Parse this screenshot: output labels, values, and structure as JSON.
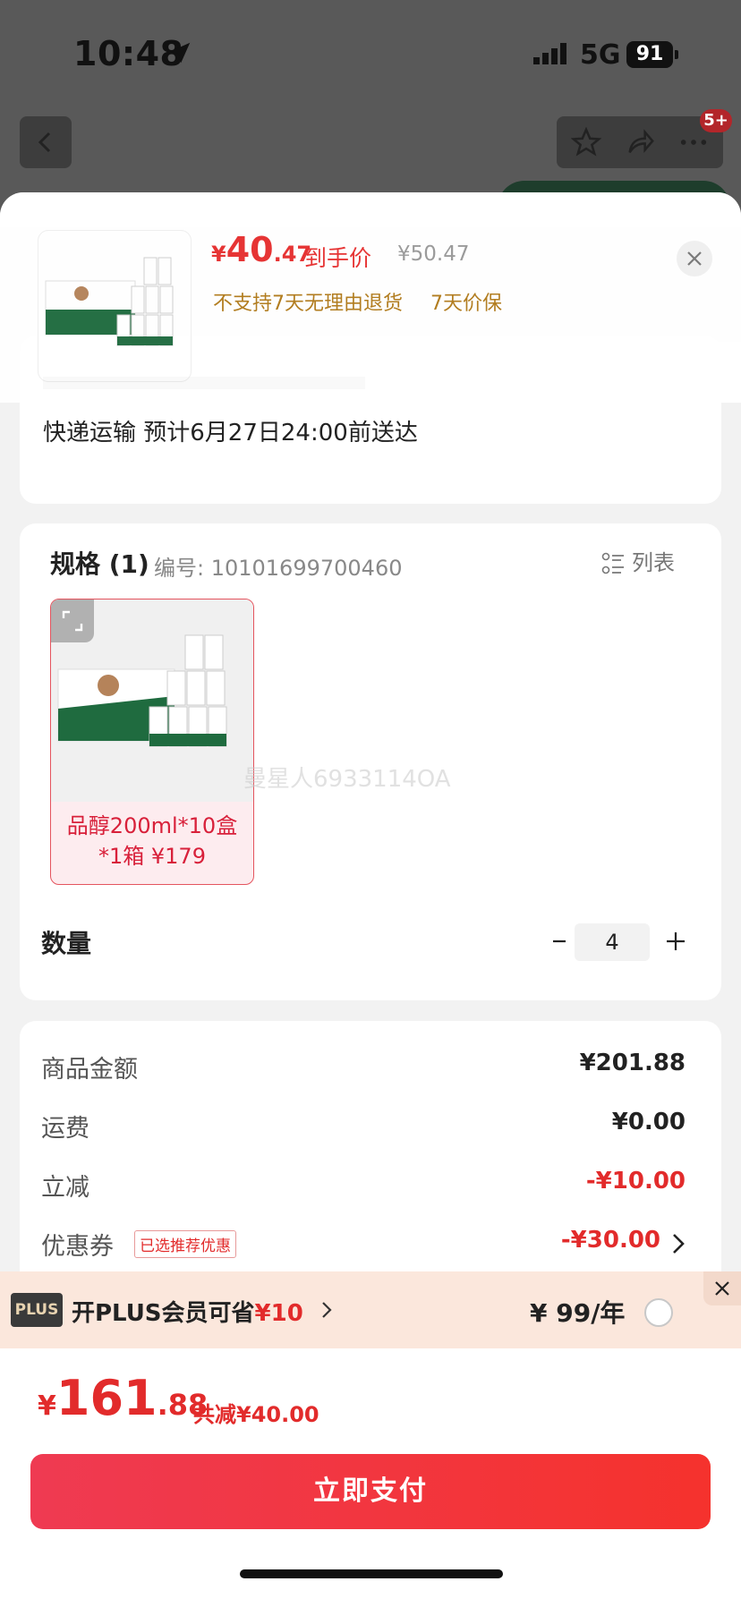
{
  "status_bar": {
    "time": "10:48",
    "network": "5G",
    "battery": "91"
  },
  "nav": {
    "cart_badge": "5+"
  },
  "sheet_header": {
    "price_currency": "¥",
    "price_int": "40",
    "price_dec": ".47",
    "price_tag": "到手价",
    "original_price": "¥50.47",
    "notes": [
      "不支持7天无理由退货",
      "7天价保"
    ]
  },
  "shipping": {
    "text": "快递运输 预计6月27日24:00前送达"
  },
  "spec": {
    "title": "规格 (1)",
    "code": "编号: 10101699700460",
    "list_label": "列表",
    "sku_label": "品醇200ml*10盒*1箱 ¥179",
    "watermark": "曼星人6933114OA",
    "quantity_label": "数量",
    "quantity_value": "4"
  },
  "summary": {
    "rows": [
      {
        "label": "商品金额",
        "value": "¥201.88"
      },
      {
        "label": "运费",
        "value": "¥0.00"
      },
      {
        "label": "立减",
        "value": "-¥10.00"
      },
      {
        "label": "优惠券",
        "value": "-¥30.00"
      }
    ],
    "coupon_tag": "已选推荐优惠"
  },
  "plus_bar": {
    "badge": "PLUS",
    "text_prefix": "开PLUS会员可省",
    "text_amount": "¥10",
    "price": "¥ 99/年"
  },
  "footer": {
    "total_currency": "¥",
    "total_int": "161",
    "total_dec": ".88",
    "total_save": "共减¥40.00",
    "pay_label": "立即支付"
  },
  "colors": {
    "accent_red": "#e22b2b",
    "note_gold": "#b07a1a",
    "plus_bg": "#fbe7dc"
  }
}
